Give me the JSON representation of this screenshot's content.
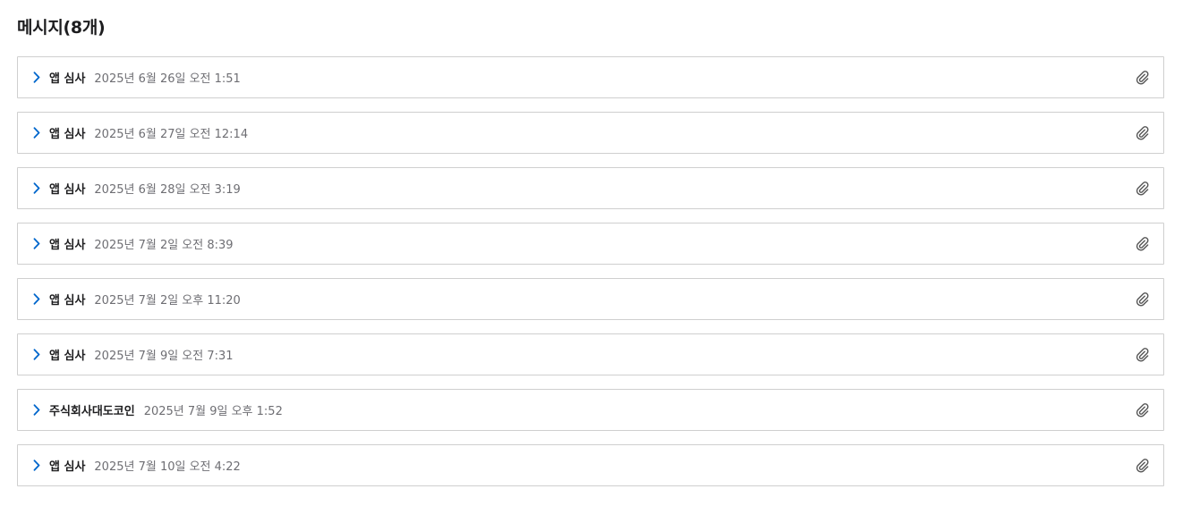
{
  "page": {
    "title": "메시지(8개)"
  },
  "colors": {
    "chevron": "#0066cc",
    "border": "#cfcfcf",
    "date_text": "#6e6e73",
    "icon": "#555555"
  },
  "messages": [
    {
      "sender": "앱 심사",
      "date": "2025년 6월 26일 오전 1:51",
      "has_attachment": true,
      "icon": "paperclip-icon"
    },
    {
      "sender": "앱 심사",
      "date": "2025년 6월 27일 오전 12:14",
      "has_attachment": true,
      "icon": "paperclip-icon"
    },
    {
      "sender": "앱 심사",
      "date": "2025년 6월 28일 오전 3:19",
      "has_attachment": true,
      "icon": "paperclip-icon"
    },
    {
      "sender": "앱 심사",
      "date": "2025년 7월 2일 오전 8:39",
      "has_attachment": true,
      "icon": "paperclip-icon"
    },
    {
      "sender": "앱 심사",
      "date": "2025년 7월 2일 오후 11:20",
      "has_attachment": true,
      "icon": "paperclip-icon"
    },
    {
      "sender": "앱 심사",
      "date": "2025년 7월 9일 오전 7:31",
      "has_attachment": true,
      "icon": "paperclip-icon"
    },
    {
      "sender": "주식회사대도코인",
      "date": "2025년 7월 9일 오후 1:52",
      "has_attachment": true,
      "icon": "paperclip-icon"
    },
    {
      "sender": "앱 심사",
      "date": "2025년 7월 10일 오전 4:22",
      "has_attachment": true,
      "icon": "paperclip-icon"
    }
  ]
}
